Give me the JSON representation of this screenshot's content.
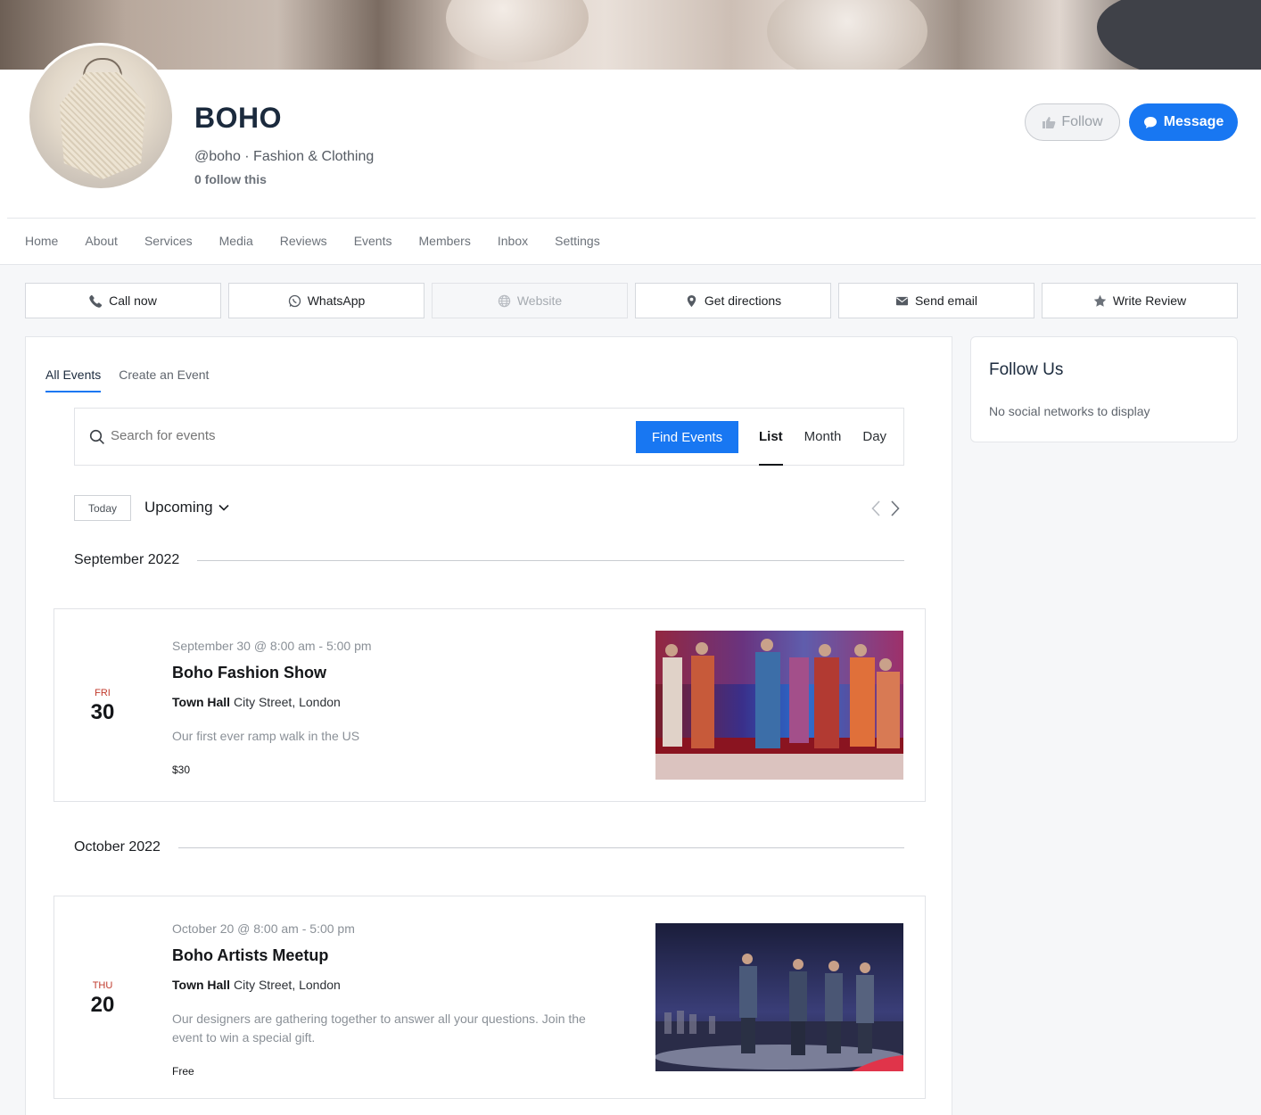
{
  "profile": {
    "name": "BOHO",
    "subtitle": "@boho · Fashion & Clothing",
    "followers": "0 follow this",
    "follow_label": "Follow",
    "message_label": "Message"
  },
  "nav": [
    "Home",
    "About",
    "Services",
    "Media",
    "Reviews",
    "Events",
    "Members",
    "Inbox",
    "Settings"
  ],
  "actions": [
    {
      "label": "Call now",
      "icon": "phone-icon"
    },
    {
      "label": "WhatsApp",
      "icon": "whatsapp-icon"
    },
    {
      "label": "Website",
      "icon": "globe-icon"
    },
    {
      "label": "Get directions",
      "icon": "map-pin-icon"
    },
    {
      "label": "Send email",
      "icon": "envelope-icon"
    },
    {
      "label": "Write Review",
      "icon": "star-icon"
    }
  ],
  "events_tabs": [
    "All Events",
    "Create an Event"
  ],
  "search": {
    "placeholder": "Search for events",
    "find_label": "Find Events"
  },
  "views": [
    "List",
    "Month",
    "Day"
  ],
  "today_label": "Today",
  "upcoming_label": "Upcoming",
  "months": [
    "September 2022",
    "October 2022"
  ],
  "events": [
    {
      "dow": "FRI",
      "day": "30",
      "time": "September 30 @ 8:00 am - 5:00 pm",
      "title": "Boho Fashion Show",
      "venue": "Town Hall",
      "address": "City Street, London",
      "desc": "Our first ever ramp walk in the US",
      "price": "$30"
    },
    {
      "dow": "THU",
      "day": "20",
      "time": "October 20 @ 8:00 am - 5:00 pm",
      "title": "Boho Artists Meetup",
      "venue": "Town Hall",
      "address": "City Street, London",
      "desc": "Our designers are gathering together to answer all your questions. Join the event to win a special gift.",
      "price": "Free"
    }
  ],
  "sidebar": {
    "title": "Follow Us",
    "text": "No social networks to display"
  },
  "colors": {
    "accent": "#1877f2",
    "dow": "#c0392b"
  }
}
